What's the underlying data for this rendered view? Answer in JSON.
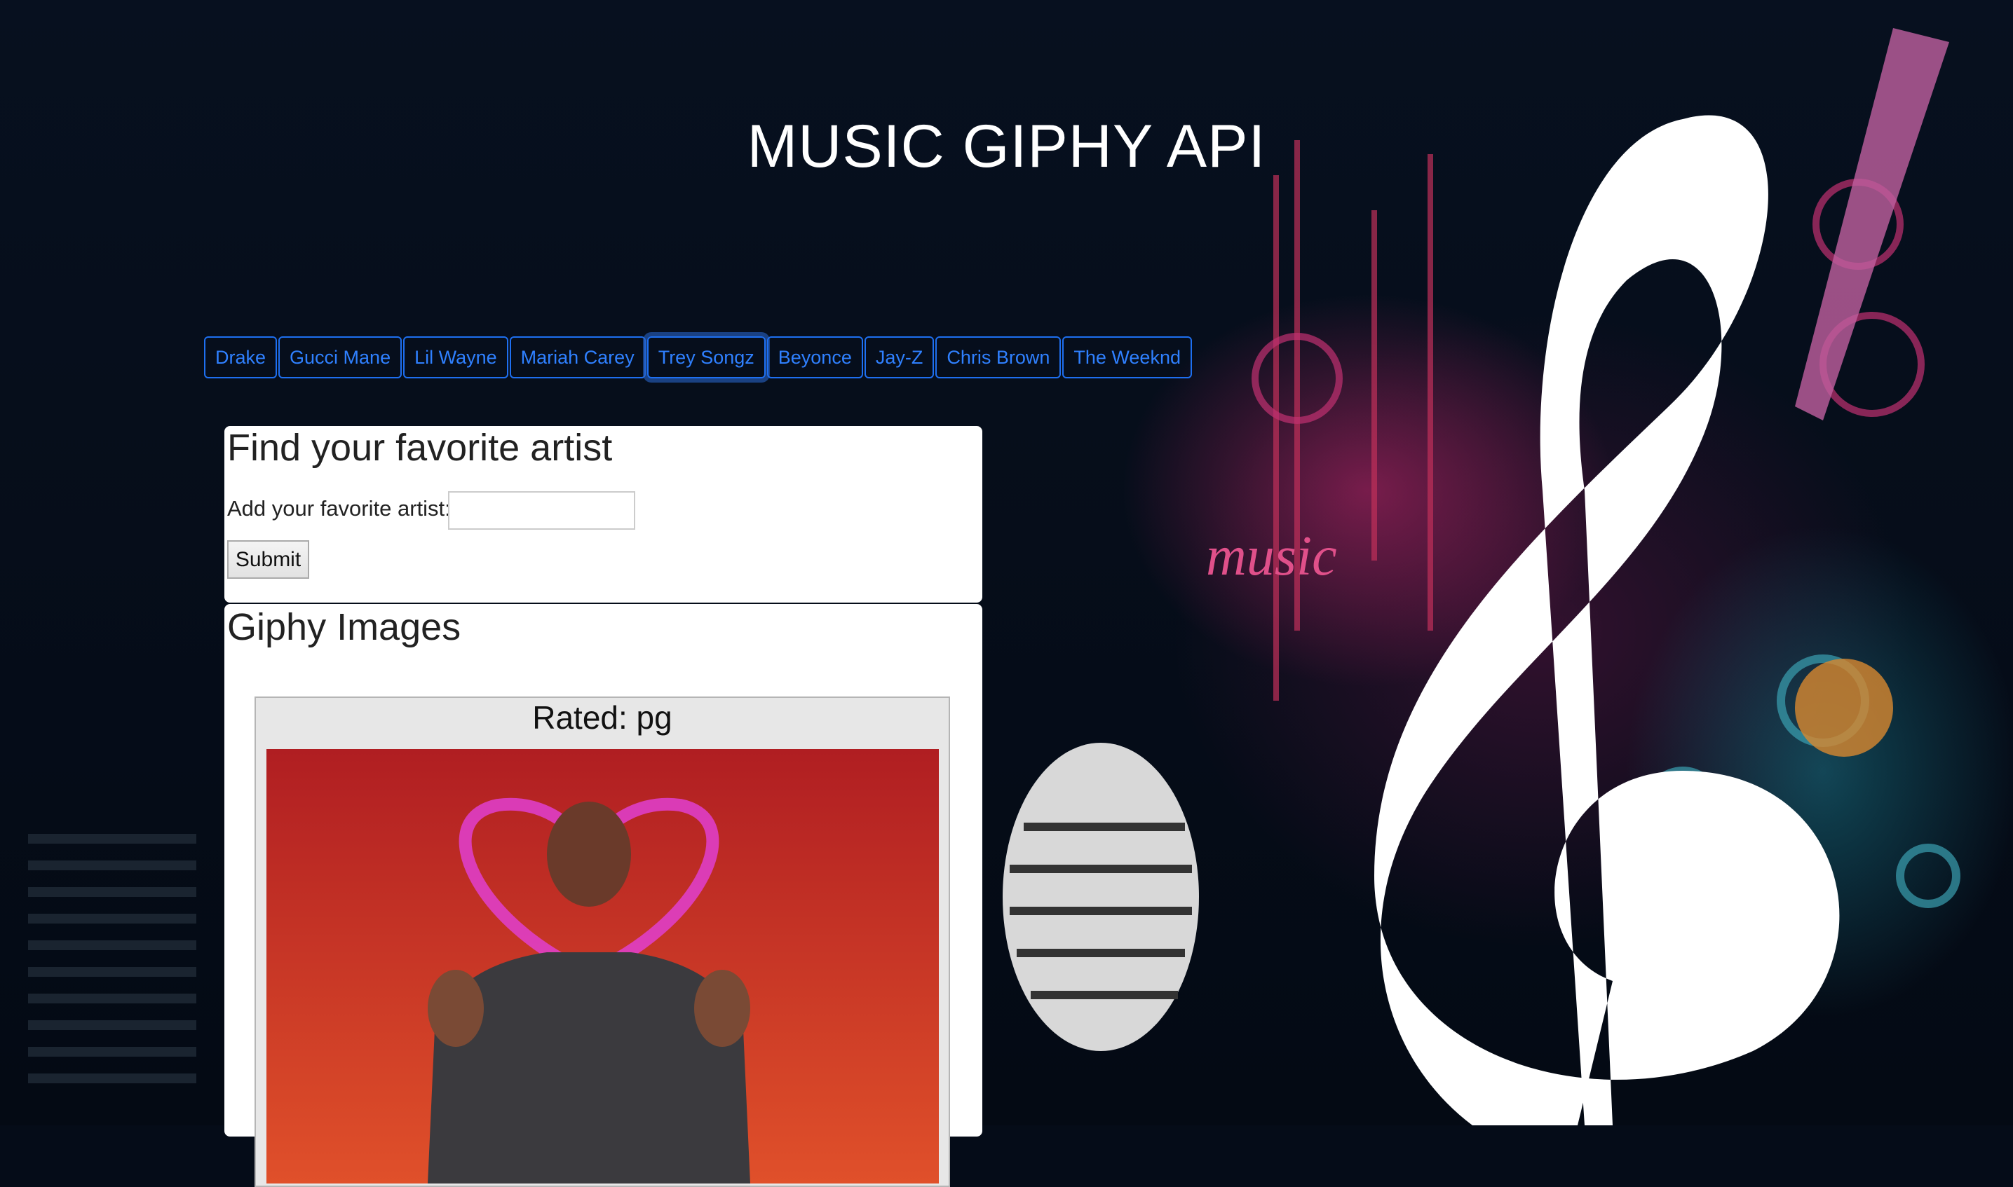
{
  "header": {
    "title": "MUSIC GIPHY API"
  },
  "artists": [
    "Drake",
    "Gucci Mane",
    "Lil Wayne",
    "Mariah Carey",
    "Trey Songz",
    "Beyonce",
    "Jay-Z",
    "Chris Brown",
    "The Weeknd"
  ],
  "focused_artist": "Trey Songz",
  "form": {
    "heading": "Find your favorite artist",
    "label": "Add your favorite artist:",
    "input_value": "",
    "submit_label": "Submit"
  },
  "results": {
    "heading": "Giphy Images",
    "cards": [
      {
        "rating_text": "Rated: pg"
      }
    ]
  },
  "colors": {
    "background": "#050c18",
    "button_accent": "#1e6ff0"
  }
}
